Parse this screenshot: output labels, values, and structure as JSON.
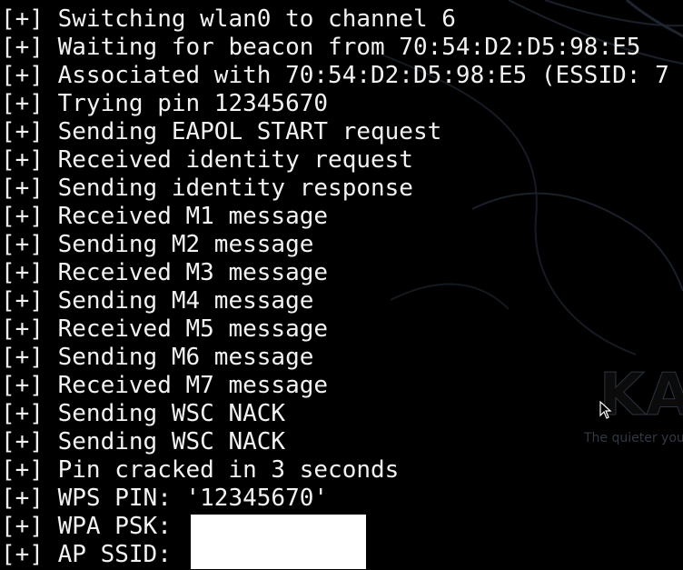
{
  "wallpaper": {
    "logo_text": "KAL",
    "tagline": "The quieter you"
  },
  "terminal": {
    "lines": [
      {
        "prefix": "[+]",
        "text": "Switching wlan0 to channel 6"
      },
      {
        "prefix": "[+]",
        "text": "Waiting for beacon from 70:54:D2:D5:98:E5"
      },
      {
        "prefix": "[+]",
        "text": "Associated with 70:54:D2:D5:98:E5 (ESSID: 7"
      },
      {
        "prefix": "[+]",
        "text": "Trying pin 12345670"
      },
      {
        "prefix": "[+]",
        "text": "Sending EAPOL START request"
      },
      {
        "prefix": "[+]",
        "text": "Received identity request"
      },
      {
        "prefix": "[+]",
        "text": "Sending identity response"
      },
      {
        "prefix": "[+]",
        "text": "Received M1 message"
      },
      {
        "prefix": "[+]",
        "text": "Sending M2 message"
      },
      {
        "prefix": "[+]",
        "text": "Received M3 message"
      },
      {
        "prefix": "[+]",
        "text": "Sending M4 message"
      },
      {
        "prefix": "[+]",
        "text": "Received M5 message"
      },
      {
        "prefix": "[+]",
        "text": "Sending M6 message"
      },
      {
        "prefix": "[+]",
        "text": "Received M7 message"
      },
      {
        "prefix": "[+]",
        "text": "Sending WSC NACK"
      },
      {
        "prefix": "[+]",
        "text": "Sending WSC NACK"
      },
      {
        "prefix": "[+]",
        "text": "Pin cracked in 3 seconds"
      },
      {
        "prefix": "[+]",
        "text": "WPS PIN: '12345670'"
      },
      {
        "prefix": "[+]",
        "text": "WPA PSK: "
      },
      {
        "prefix": "[+]",
        "text": "AP SSID: "
      }
    ]
  },
  "colors": {
    "background": "#000000",
    "text": "#f2f2f2",
    "redaction": "#ffffff"
  },
  "icons": {
    "cursor": "mouse-pointer-icon"
  }
}
